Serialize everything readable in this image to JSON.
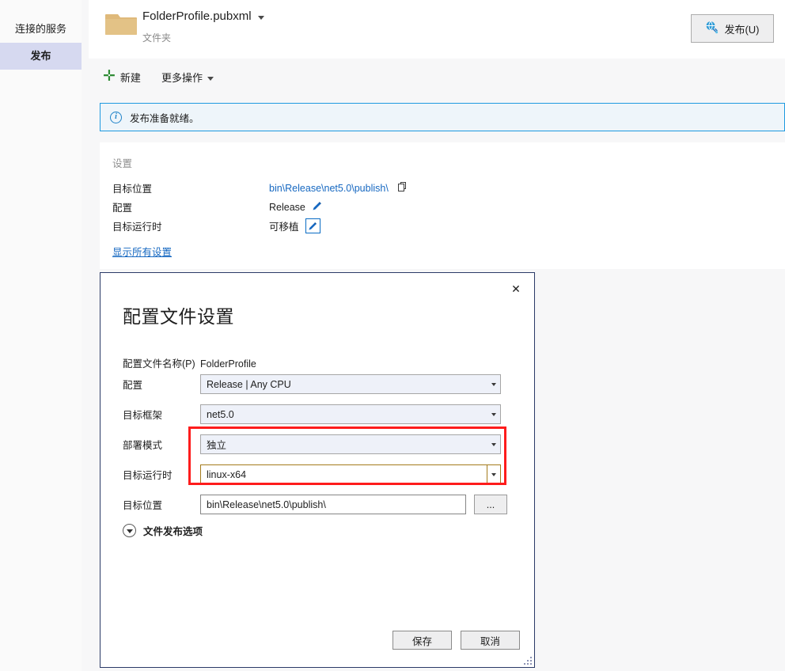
{
  "sidebar": {
    "items": [
      {
        "label": "连接的服务",
        "selected": false
      },
      {
        "label": "发布",
        "selected": true
      }
    ]
  },
  "header": {
    "icon": "folder-icon",
    "title": "FolderProfile.pubxml",
    "subtitle": "文件夹",
    "publish_button": {
      "label": "发布(U)",
      "icon": "publish-globe-icon"
    }
  },
  "toolbar": {
    "new_label": "新建",
    "more_actions_label": "更多操作"
  },
  "info_bar": {
    "icon": "info-icon",
    "text": "发布准备就绪。"
  },
  "settings": {
    "title": "设置",
    "rows": [
      {
        "label": "目标位置",
        "value": "bin\\Release\\net5.0\\publish\\",
        "is_link": true,
        "trailing_icon": "copy-icon"
      },
      {
        "label": "配置",
        "value": "Release",
        "is_link": false,
        "trailing_icon": "pencil-icon"
      },
      {
        "label": "目标运行时",
        "value": "可移植",
        "is_link": false,
        "trailing_icon": "pencil-boxed-icon"
      }
    ],
    "show_all_label": "显示所有设置"
  },
  "dialog": {
    "title": "配置文件设置",
    "close_label": "✕",
    "profile_name_label": "配置文件名称(P)",
    "profile_name_value": "FolderProfile",
    "fields": [
      {
        "label": "配置",
        "value": "Release | Any CPU",
        "type": "combobox",
        "focused": false
      },
      {
        "label": "目标框架",
        "value": "net5.0",
        "type": "combobox",
        "focused": false
      },
      {
        "label": "部署模式",
        "value": "独立",
        "type": "combobox",
        "focused": false
      },
      {
        "label": "目标运行时",
        "value": "linux-x64",
        "type": "combobox",
        "focused": true
      },
      {
        "label": "目标位置",
        "value": "bin\\Release\\net5.0\\publish\\",
        "type": "textbox",
        "browse_label": "..."
      }
    ],
    "expander_label": "文件发布选项",
    "save_label": "保存",
    "cancel_label": "取消"
  },
  "colors": {
    "accent_link": "#1668c1",
    "info_border": "#1e9ae0",
    "highlight_red": "#fe1c1c",
    "focus_gold": "#a47b1d",
    "sidebar_selected": "#d6d9f0",
    "dialog_border": "#2b3a67",
    "plus_green": "#2e8b34"
  }
}
